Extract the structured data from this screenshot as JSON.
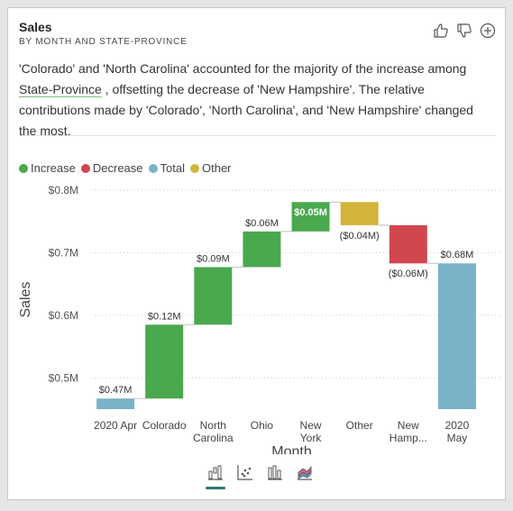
{
  "visual": {
    "title": "Sales",
    "subtitle": "BY MONTH AND STATE-PROVINCE",
    "actions": [
      {
        "icon": "thumbs-up-icon"
      },
      {
        "icon": "thumbs-down-icon"
      },
      {
        "icon": "plus-circle-icon"
      }
    ]
  },
  "narrative": {
    "part1": "'Colorado' and 'North Carolina' accounted for the majority of the increase among ",
    "link": "State-Province",
    "part2": " , offsetting the decrease of 'New Hampshire'. The relative contributions made by 'Colorado', 'North Carolina', and 'New Hampshire' changed the most."
  },
  "legend": [
    {
      "label": "Increase",
      "color": "#4aa84e"
    },
    {
      "label": "Decrease",
      "color": "#d1474f"
    },
    {
      "label": "Total",
      "color": "#7ab3c8"
    },
    {
      "label": "Other",
      "color": "#d4b43a"
    }
  ],
  "chart_data": {
    "type": "waterfall",
    "xlabel": "Month",
    "ylabel": "Sales",
    "ylim": [
      0.45,
      0.8
    ],
    "yticks": [
      "$0.8M",
      "$0.7M",
      "$0.6M",
      "$0.5M"
    ],
    "ytick_values": [
      0.8,
      0.7,
      0.6,
      0.5
    ],
    "grid": true,
    "legend_position": "top-left",
    "steps": [
      {
        "category": [
          "2020 Apr"
        ],
        "start": 0.45,
        "end": 0.467,
        "kind": "Total",
        "label": "$0.47M"
      },
      {
        "category": [
          "Colorado"
        ],
        "start": 0.467,
        "end": 0.585,
        "kind": "Increase",
        "label": "$0.12M"
      },
      {
        "category": [
          "North",
          "Carolina"
        ],
        "start": 0.585,
        "end": 0.677,
        "kind": "Increase",
        "label": "$0.09M"
      },
      {
        "category": [
          "Ohio"
        ],
        "start": 0.677,
        "end": 0.734,
        "kind": "Increase",
        "label": "$0.06M"
      },
      {
        "category": [
          "New",
          "York"
        ],
        "start": 0.734,
        "end": 0.781,
        "kind": "Increase",
        "label": "$0.05M"
      },
      {
        "category": [
          "Other"
        ],
        "start": 0.781,
        "end": 0.744,
        "kind": "Other",
        "label": "($0.04M)"
      },
      {
        "category": [
          "New",
          "Hamp..."
        ],
        "start": 0.744,
        "end": 0.683,
        "kind": "Decrease",
        "label": "($0.06M)"
      },
      {
        "category": [
          "2020",
          "May"
        ],
        "start": 0.45,
        "end": 0.683,
        "kind": "Total",
        "label": "$0.68M"
      }
    ]
  },
  "visual_tabs": [
    {
      "icon": "waterfall-chart-icon",
      "active": true
    },
    {
      "icon": "scatter-chart-icon",
      "active": false
    },
    {
      "icon": "bar-chart-icon",
      "active": false
    },
    {
      "icon": "ribbon-chart-icon",
      "active": false
    }
  ]
}
